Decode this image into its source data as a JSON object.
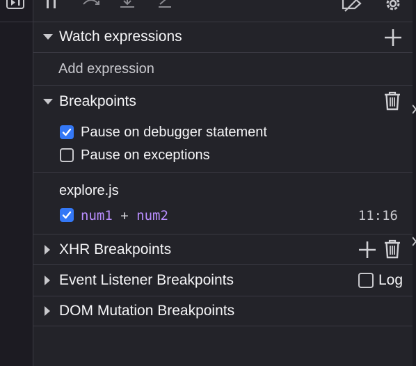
{
  "toolbar": {
    "icons": [
      "pause-icon",
      "step-over-icon",
      "step-in-icon",
      "step-out-icon",
      "deactivate-breakpoints-icon",
      "settings-gear-icon"
    ]
  },
  "watch": {
    "title": "Watch expressions",
    "add_placeholder": "Add expression"
  },
  "breakpoints": {
    "title": "Breakpoints",
    "options": [
      {
        "label": "Pause on debugger statement",
        "checked": true
      },
      {
        "label": "Pause on exceptions",
        "checked": false
      }
    ],
    "file": "explore.js",
    "entry": {
      "var1": "num1",
      "op": "+",
      "var2": "num2",
      "location": "11:16",
      "checked": true
    }
  },
  "sections": {
    "xhr": "XHR Breakpoints",
    "event": "Event Listener Breakpoints",
    "event_log": "Log",
    "dom": "DOM Mutation Breakpoints"
  },
  "colors": {
    "background": "#232329",
    "accent": "#3478f6",
    "code_var": "#b98eff"
  }
}
